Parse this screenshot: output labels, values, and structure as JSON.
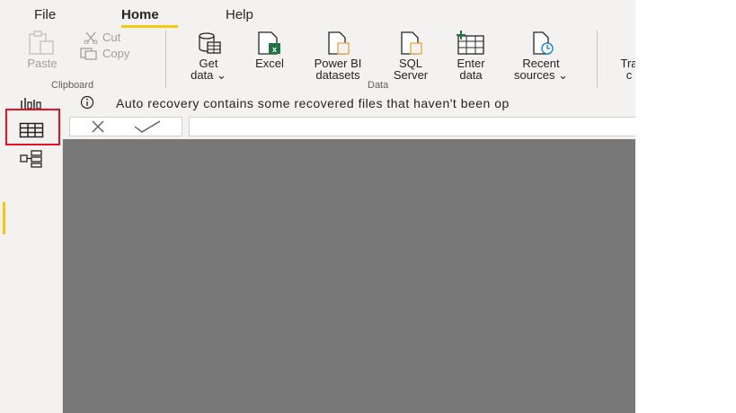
{
  "menu": {
    "tabs": [
      {
        "label": "File"
      },
      {
        "label": "Home"
      },
      {
        "label": "Help"
      }
    ]
  },
  "ribbon": {
    "clipboard": {
      "paste": "Paste",
      "cut": "Cut",
      "copy": "Copy",
      "group_label": "Clipboard"
    },
    "data": {
      "get_data": [
        "Get",
        "data ⌄"
      ],
      "excel": "Excel",
      "powerbi": [
        "Power BI",
        "datasets"
      ],
      "sql": [
        "SQL",
        "Server"
      ],
      "enter": [
        "Enter",
        "data"
      ],
      "recent": [
        "Recent",
        "sources ⌄"
      ],
      "group_label": "Data"
    },
    "transform": [
      "Tra",
      "c"
    ]
  },
  "infobar": {
    "message": "Auto recovery contains some recovered files that haven't been op"
  },
  "colors": {
    "accent": "#f2c811",
    "highlight": "#e81123",
    "excel_green": "#217346",
    "canvas": "#787878"
  }
}
